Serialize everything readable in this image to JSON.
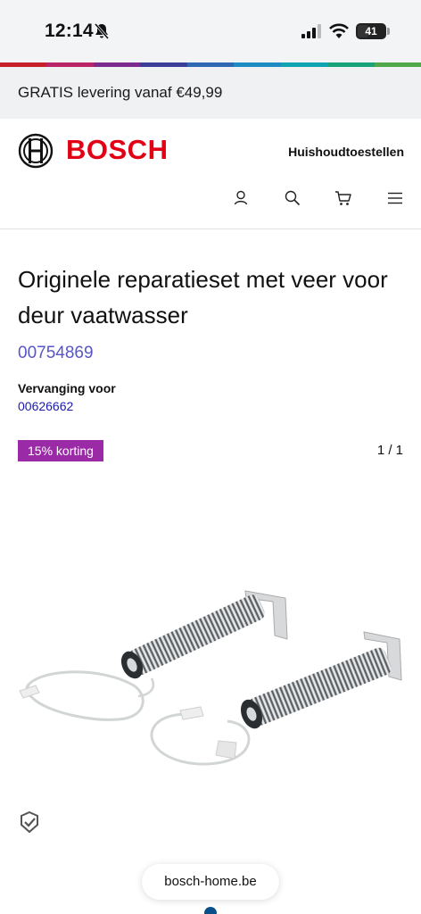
{
  "status": {
    "time": "12:14",
    "battery": "41",
    "battery_level": 0.41
  },
  "stripe_colors": [
    "#c8202b",
    "#b92566",
    "#7d2a8f",
    "#3c3f99",
    "#2f68b3",
    "#1d8cc3",
    "#0ea5b0",
    "#19a37a",
    "#4fa84a"
  ],
  "promo": {
    "text": "GRATIS levering vanaf €49,99"
  },
  "header": {
    "brand": "BOSCH",
    "brand_color": "#e20015",
    "nav_category": "Huishoudtoestellen",
    "icons": [
      "user-icon",
      "search-icon",
      "cart-icon",
      "menu-icon"
    ]
  },
  "product": {
    "title": "Originele reparatieset met veer voor deur vaatwasser",
    "number": "00754869",
    "replacement_label": "Vervanging voor",
    "replacement_number": "00626662",
    "discount": "15% korting",
    "gallery_counter": "1 / 1"
  },
  "browser": {
    "url": "bosch-home.be"
  }
}
